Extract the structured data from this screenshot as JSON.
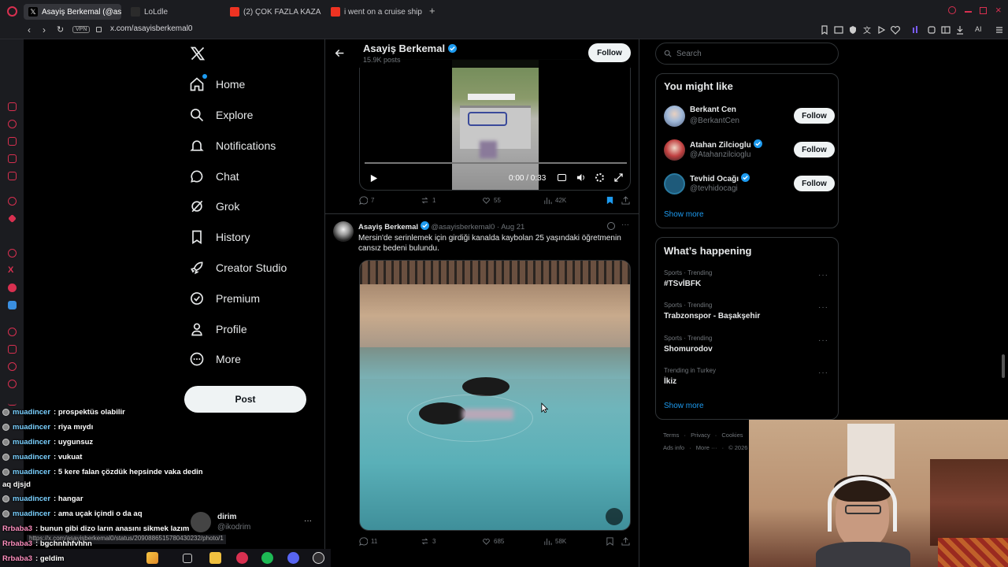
{
  "browser": {
    "tabs": [
      {
        "label": "Asayiş Berkemal (@asayis",
        "active": true
      },
      {
        "label": "LoLdle",
        "active": false
      },
      {
        "label": "(2) ÇOK FAZLA KAZA | 5Se",
        "active": false
      },
      {
        "label": "i went on a cruise ship - Yo",
        "active": false
      }
    ],
    "vpn_label": "VPN",
    "url": "x.com/asayisberkemal0",
    "status_url": "https://x.com/asayisberkemal0/status/2090886515780430232/photo/1",
    "ai_label": "AI"
  },
  "nav": {
    "items": [
      {
        "label": "Home",
        "icon": "home-icon"
      },
      {
        "label": "Explore",
        "icon": "search-icon"
      },
      {
        "label": "Notifications",
        "icon": "bell-icon"
      },
      {
        "label": "Chat",
        "icon": "chat-icon"
      },
      {
        "label": "Grok",
        "icon": "grok-icon"
      },
      {
        "label": "History",
        "icon": "bookmark-icon"
      },
      {
        "label": "Creator Studio",
        "icon": "rocket-icon"
      },
      {
        "label": "Premium",
        "icon": "premium-icon"
      },
      {
        "label": "Profile",
        "icon": "profile-icon"
      },
      {
        "label": "More",
        "icon": "more-icon"
      }
    ],
    "post_label": "Post",
    "account": {
      "name": "dirim",
      "handle": "@ikodrim"
    }
  },
  "profile_header": {
    "name": "Asayiş Berkemal",
    "posts": "15.9K posts",
    "follow_label": "Follow"
  },
  "video_post": {
    "time": "0:00 / 0:33",
    "replies": "7",
    "reposts": "1",
    "likes": "55",
    "views": "42K"
  },
  "photo_post": {
    "author": "Asayiş Berkemal",
    "handle": "@asayisberkemal0",
    "date": "· Aug 21",
    "text": "Mersin'de serinlemek için girdiği kanalda kaybolan 25 yaşındaki öğretmenin cansız bedeni bulundu.",
    "replies": "11",
    "reposts": "3",
    "likes": "685",
    "views": "58K"
  },
  "search": {
    "placeholder": "Search"
  },
  "you_might_like": {
    "title": "You might like",
    "users": [
      {
        "name": "Berkant Cen",
        "handle": "@BerkantCen",
        "verified": false
      },
      {
        "name": "Atahan Zilcioglu",
        "handle": "@Atahanzilcioglu",
        "verified": true
      },
      {
        "name": "Tevhid Ocağı",
        "handle": "@tevhidocagi",
        "verified": true
      }
    ],
    "follow_label": "Follow",
    "show_more": "Show more"
  },
  "whats_happening": {
    "title": "What’s happening",
    "trends": [
      {
        "meta": "Sports · Trending",
        "title": "#TSvİBFK"
      },
      {
        "meta": "Sports · Trending",
        "title": "Trabzonspor - Başakşehir"
      },
      {
        "meta": "Sports · Trending",
        "title": "Shomurodov"
      },
      {
        "meta": "Trending in Turkey",
        "title": "İkiz"
      }
    ],
    "show_more": "Show more"
  },
  "footer": {
    "links": [
      "Terms",
      "Privacy",
      "Cookies"
    ],
    "links2": [
      "Ads info",
      "More ···",
      "© 2026 X"
    ]
  },
  "chat": [
    {
      "user": "muadincer",
      "msg": ": prospektüs olabilir"
    },
    {
      "user": "muadincer",
      "msg": ": riya mıydı"
    },
    {
      "user": "muadincer",
      "msg": ": uygunsuz"
    },
    {
      "user": "muadincer",
      "msg": ": vukuat"
    },
    {
      "user": "muadincer",
      "msg": ": 5 kere falan çözdük hepsinde vaka dedin"
    },
    {
      "user": "",
      "msg": "aq djsjd"
    },
    {
      "user": "muadincer",
      "msg": ": hangar"
    },
    {
      "user": "muadincer",
      "msg": ": ama uçak içindi o da aq"
    },
    {
      "user": "Rrbaba3",
      "msg": ": bunun gibi dizo ların anasını sikmek lazım"
    },
    {
      "user": "Rrbaba3",
      "msg": ": bgchnhhfvhhn"
    },
    {
      "user": "Rrbaba3",
      "msg": ": geldim"
    }
  ],
  "colors": {
    "accent": "#1d9bf0",
    "bg": "#000000",
    "border": "#2f3336",
    "muted": "#71767b"
  }
}
